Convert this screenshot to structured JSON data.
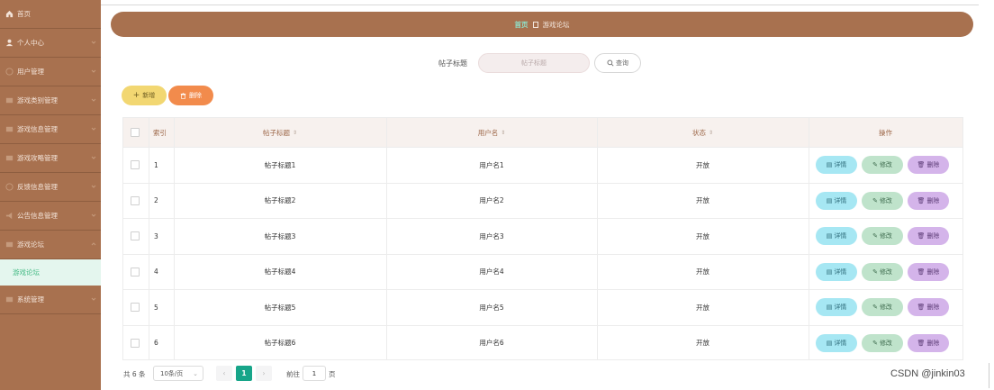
{
  "sidebar": {
    "items": [
      {
        "label": "首页"
      },
      {
        "label": "个人中心"
      },
      {
        "label": "用户管理"
      },
      {
        "label": "游戏类别管理"
      },
      {
        "label": "游戏信息管理"
      },
      {
        "label": "游戏攻略管理"
      },
      {
        "label": "反馈信息管理"
      },
      {
        "label": "公告信息管理"
      },
      {
        "label": "游戏论坛"
      }
    ],
    "active_sub": "游戏论坛",
    "last_item": "系统管理"
  },
  "breadcrumb": {
    "home": "首页",
    "current": "游戏论坛"
  },
  "search": {
    "label": "帖子标题",
    "placeholder": "帖子标题",
    "button": "查询"
  },
  "actions": {
    "add": "新增",
    "delete": "删除"
  },
  "table": {
    "headers": {
      "index": "索引",
      "title": "帖子标题",
      "username": "用户名",
      "status": "状态",
      "ops": "操作"
    },
    "rows": [
      {
        "index": "1",
        "title": "帖子标题1",
        "username": "用户名1",
        "status": "开放"
      },
      {
        "index": "2",
        "title": "帖子标题2",
        "username": "用户名2",
        "status": "开放"
      },
      {
        "index": "3",
        "title": "帖子标题3",
        "username": "用户名3",
        "status": "开放"
      },
      {
        "index": "4",
        "title": "帖子标题4",
        "username": "用户名4",
        "status": "开放"
      },
      {
        "index": "5",
        "title": "帖子标题5",
        "username": "用户名5",
        "status": "开放"
      },
      {
        "index": "6",
        "title": "帖子标题6",
        "username": "用户名6",
        "status": "开放"
      }
    ],
    "op_labels": {
      "detail": "详情",
      "edit": "修改",
      "delete": "删除"
    }
  },
  "pagination": {
    "total": "共 6 条",
    "page_size": "10条/页",
    "current": "1",
    "goto_prefix": "前往",
    "goto_value": "1",
    "goto_suffix": "页"
  },
  "watermark": "CSDN @jinkin03",
  "colors": {
    "sidebar": "#a8714f",
    "accent": "#17a589",
    "add": "#f2d772",
    "delete": "#f28b4c"
  }
}
